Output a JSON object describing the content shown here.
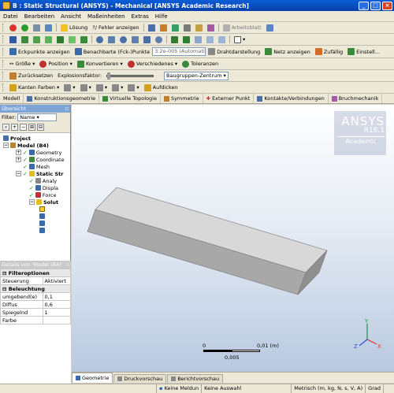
{
  "window": {
    "title": "B : Static Structural (ANSYS) - Mechanical [ANSYS Academic Research]"
  },
  "menu": [
    "Datei",
    "Bearbeiten",
    "Ansicht",
    "Maßeinheiten",
    "Extras",
    "Hilfe"
  ],
  "toolbar1": {
    "solve_label": "Lösung",
    "error_label": "?/ Fehler anzeigen",
    "worksheet_label": "Arbeitsblatt"
  },
  "toolbar3": {
    "vertices_label": "Eckpunkte anzeigen",
    "adjacent_label": "Benachbarte (Fck-)Punkte",
    "tolerance_value": "3.2e-005 (Automatisch sk…",
    "wireframe_label": "Drahtdarstellung",
    "mesh_label": "Netz anzeigen",
    "random_label": "Zufällig",
    "random_colors_label": "Einstell..."
  },
  "toolbar4": {
    "size_label": "Größe",
    "position_label": "Position",
    "convert_label": "Konvertieren",
    "misc_label": "Verschiedenes",
    "tolerance_label": "Toleranzen"
  },
  "toolbar5": {
    "reset_label": "Zurücksetzen",
    "explode_label": "Explosionsfaktor:",
    "assembly_center": "Baugruppen-Zentrum"
  },
  "toolbar6": {
    "edge_colors_label": "Kanten Farben",
    "thicken_label": "Aufdicken"
  },
  "context_tabs": [
    "Modell",
    "Konstruktionsgeometrie",
    "Virtuelle Topologie",
    "Symmetrie",
    "Externer Punkt",
    "Kontakte/Verbindungen",
    "Bruchmechanik"
  ],
  "outline": {
    "header": "Übersicht",
    "filter_label": "Filter:",
    "filter_value": "Name",
    "nodes": {
      "project": "Project",
      "model": "Model (B4)",
      "geometry": "Geometry",
      "coordinate": "Coordinate",
      "mesh": "Mesh",
      "static": "Static Str",
      "analysis": "Analy",
      "displacement": "Displa",
      "force": "Force",
      "solution": "Solut"
    }
  },
  "details": {
    "header": "Details von 'Model (B4)'",
    "sections": {
      "filter": "Filteroptionen",
      "lighting": "Beleuchtung"
    },
    "rows": {
      "control_label": "Steuerung",
      "control_value": "Aktiviert",
      "ambient_label": "umgebend(e)",
      "ambient_value": "0,1",
      "diffuse_label": "Diffus",
      "diffuse_value": "0,6",
      "specular_label": "Spiegelnd",
      "specular_value": "1",
      "color_label": "Farbe",
      "color_value": ""
    }
  },
  "viewport": {
    "brand": "ANSYS",
    "version": "R18.1",
    "edition": "Academic",
    "scale_start": "0",
    "scale_end": "0,01 (m)",
    "scale_mid": "0,005",
    "axis_x": "X",
    "axis_y": "Y",
    "axis_z": "Z"
  },
  "bottom_tabs": [
    "Geometrie",
    "Druckvorschau",
    "Berichtvorschau"
  ],
  "status": {
    "messages": "Keine Meldun",
    "selection": "Keine Auswahl",
    "units": "Metrisch (m, kg, N, s, V, A)",
    "angle": "Grad"
  },
  "colors": {
    "title_bar": "#0a5ed7",
    "viewport_top": "#ffffff",
    "viewport_bottom": "#b9c9e0",
    "block_top": "#d8d8d8",
    "block_front": "#a8a8a8",
    "block_end": "#8f8f8f",
    "check_green": "#1a9a1a"
  }
}
